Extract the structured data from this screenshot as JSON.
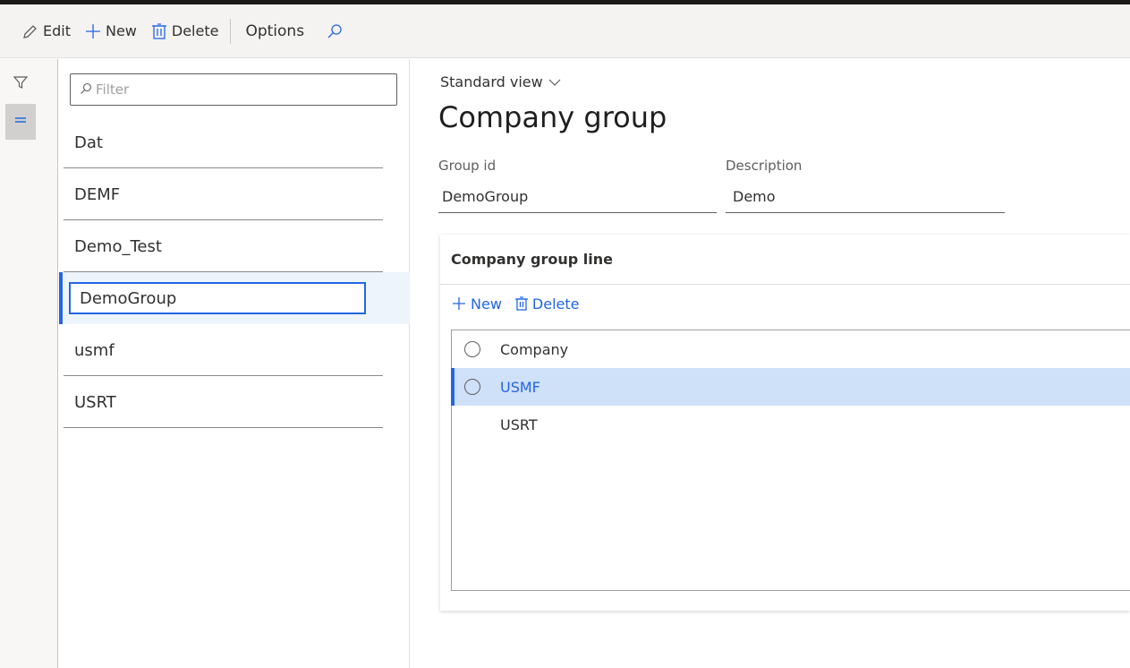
{
  "actionpane": {
    "edit_label": "Edit",
    "new_label": "New",
    "delete_label": "Delete",
    "options_label": "Options"
  },
  "list": {
    "filter_placeholder": "Filter",
    "items": [
      "Dat",
      "DEMF",
      "Demo_Test",
      "DemoGroup",
      "usmf",
      "USRT"
    ],
    "selected": "DemoGroup"
  },
  "detail": {
    "view_label": "Standard view",
    "title": "Company group",
    "group_id_label": "Group id",
    "group_id_value": "DemoGroup",
    "description_label": "Description",
    "description_value": "Demo"
  },
  "grid": {
    "title": "Company group line",
    "new_label": "New",
    "delete_label": "Delete",
    "column_header": "Company",
    "rows": [
      "USMF",
      "USRT"
    ],
    "selected_row": "USMF"
  },
  "colors": {
    "accent": "#2266e3",
    "selected_row_bg": "#cfe0f9"
  }
}
